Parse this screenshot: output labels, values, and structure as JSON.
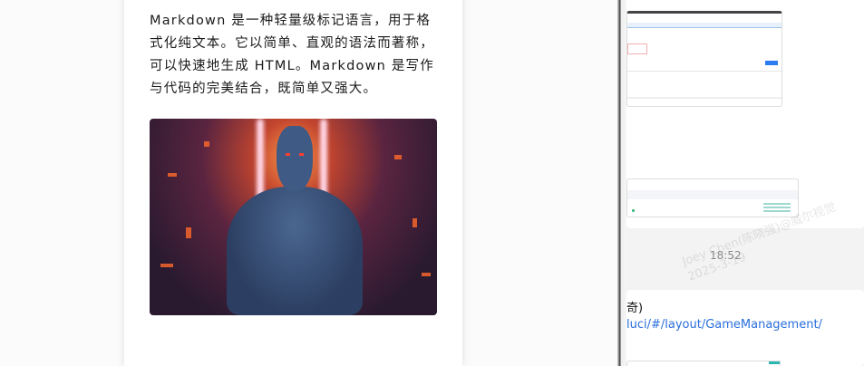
{
  "article": {
    "paragraph": "Markdown 是一种轻量级标记语言，用于格式化纯文本。它以简单、直观的语法而著称，可以快速地生成 HTML。Markdown 是写作与代码的完美结合，既简单又强大。"
  },
  "chat": {
    "time": "18:52",
    "watermark": [
      "Joey Chen(陈晓强)@威尔视觉",
      "2025-3-19"
    ],
    "message_fragment": "奇)",
    "link": "luci/#/layout/GameManagement/"
  }
}
